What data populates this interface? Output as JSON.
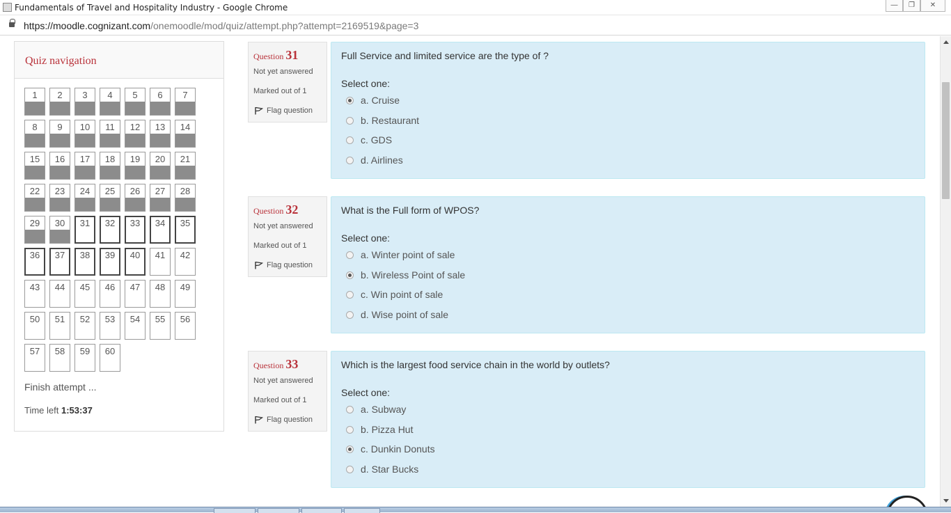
{
  "window": {
    "title": "Fundamentals of Travel and Hospitality Industry - Google Chrome",
    "controls": {
      "minimize": "—",
      "maximize": "❐",
      "close": "✕"
    }
  },
  "addressbar": {
    "url_host": "https://moodle.cognizant.com",
    "url_path": "/onemoodle/mod/quiz/attempt.php?attempt=2169519&page=3"
  },
  "quiznav": {
    "title": "Quiz navigation",
    "finish_label": "Finish attempt ...",
    "time_left_label": "Time left",
    "time_left_value": "1:53:37",
    "questions": [
      {
        "n": "1",
        "state": "answered"
      },
      {
        "n": "2",
        "state": "answered"
      },
      {
        "n": "3",
        "state": "answered"
      },
      {
        "n": "4",
        "state": "answered"
      },
      {
        "n": "5",
        "state": "answered"
      },
      {
        "n": "6",
        "state": "answered"
      },
      {
        "n": "7",
        "state": "answered"
      },
      {
        "n": "8",
        "state": "answered"
      },
      {
        "n": "9",
        "state": "answered"
      },
      {
        "n": "10",
        "state": "answered"
      },
      {
        "n": "11",
        "state": "answered"
      },
      {
        "n": "12",
        "state": "answered"
      },
      {
        "n": "13",
        "state": "answered"
      },
      {
        "n": "14",
        "state": "answered"
      },
      {
        "n": "15",
        "state": "answered"
      },
      {
        "n": "16",
        "state": "answered"
      },
      {
        "n": "17",
        "state": "answered"
      },
      {
        "n": "18",
        "state": "answered"
      },
      {
        "n": "19",
        "state": "answered"
      },
      {
        "n": "20",
        "state": "answered"
      },
      {
        "n": "21",
        "state": "answered"
      },
      {
        "n": "22",
        "state": "answered"
      },
      {
        "n": "23",
        "state": "answered"
      },
      {
        "n": "24",
        "state": "answered"
      },
      {
        "n": "25",
        "state": "answered"
      },
      {
        "n": "26",
        "state": "answered"
      },
      {
        "n": "27",
        "state": "answered"
      },
      {
        "n": "28",
        "state": "answered"
      },
      {
        "n": "29",
        "state": "answered"
      },
      {
        "n": "30",
        "state": "answered"
      },
      {
        "n": "31",
        "state": "thispage"
      },
      {
        "n": "32",
        "state": "thispage"
      },
      {
        "n": "33",
        "state": "thispage"
      },
      {
        "n": "34",
        "state": "thispage"
      },
      {
        "n": "35",
        "state": "thispage"
      },
      {
        "n": "36",
        "state": "thispage"
      },
      {
        "n": "37",
        "state": "thispage"
      },
      {
        "n": "38",
        "state": "thispage"
      },
      {
        "n": "39",
        "state": "thispage"
      },
      {
        "n": "40",
        "state": "thispage"
      },
      {
        "n": "41",
        "state": "unanswered"
      },
      {
        "n": "42",
        "state": "unanswered"
      },
      {
        "n": "43",
        "state": "unanswered"
      },
      {
        "n": "44",
        "state": "unanswered"
      },
      {
        "n": "45",
        "state": "unanswered"
      },
      {
        "n": "46",
        "state": "unanswered"
      },
      {
        "n": "47",
        "state": "unanswered"
      },
      {
        "n": "48",
        "state": "unanswered"
      },
      {
        "n": "49",
        "state": "unanswered"
      },
      {
        "n": "50",
        "state": "unanswered"
      },
      {
        "n": "51",
        "state": "unanswered"
      },
      {
        "n": "52",
        "state": "unanswered"
      },
      {
        "n": "53",
        "state": "unanswered"
      },
      {
        "n": "54",
        "state": "unanswered"
      },
      {
        "n": "55",
        "state": "unanswered"
      },
      {
        "n": "56",
        "state": "unanswered"
      },
      {
        "n": "57",
        "state": "unanswered"
      },
      {
        "n": "58",
        "state": "unanswered"
      },
      {
        "n": "59",
        "state": "unanswered"
      },
      {
        "n": "60",
        "state": "unanswered"
      }
    ]
  },
  "questions": [
    {
      "label": "Question",
      "number": "31",
      "state": "Not yet answered",
      "grade": "Marked out of 1",
      "flag": "Flag question",
      "text": "Full Service and limited service are the type of ?",
      "prompt": "Select one:",
      "options": [
        {
          "label": "a. Cruise",
          "checked": true
        },
        {
          "label": "b. Restaurant",
          "checked": false
        },
        {
          "label": "c. GDS",
          "checked": false
        },
        {
          "label": "d. Airlines",
          "checked": false
        }
      ]
    },
    {
      "label": "Question",
      "number": "32",
      "state": "Not yet answered",
      "grade": "Marked out of 1",
      "flag": "Flag question",
      "text": "What is the Full form of WPOS?",
      "prompt": "Select one:",
      "options": [
        {
          "label": "a. Winter point of sale",
          "checked": false
        },
        {
          "label": "b. Wireless Point of sale",
          "checked": true
        },
        {
          "label": "c. Win point of sale",
          "checked": false
        },
        {
          "label": "d. Wise point of sale",
          "checked": false
        }
      ]
    },
    {
      "label": "Question",
      "number": "33",
      "state": "Not yet answered",
      "grade": "Marked out of 1",
      "flag": "Flag question",
      "text": "Which is the largest food service chain in the world by outlets?",
      "prompt": "Select one:",
      "options": [
        {
          "label": "a. Subway",
          "checked": false
        },
        {
          "label": "b. Pizza Hut",
          "checked": false
        },
        {
          "label": "c. Dunkin Donuts",
          "checked": true
        },
        {
          "label": "d. Star Bucks",
          "checked": false
        }
      ]
    }
  ],
  "icons": {
    "flag": "flag-icon",
    "support": "headset-icon",
    "lock": "lock-icon"
  },
  "colors": {
    "accent_red": "#b9323a",
    "answer_panel": "#d9edf7",
    "answered_fill": "#8c8c8c"
  }
}
